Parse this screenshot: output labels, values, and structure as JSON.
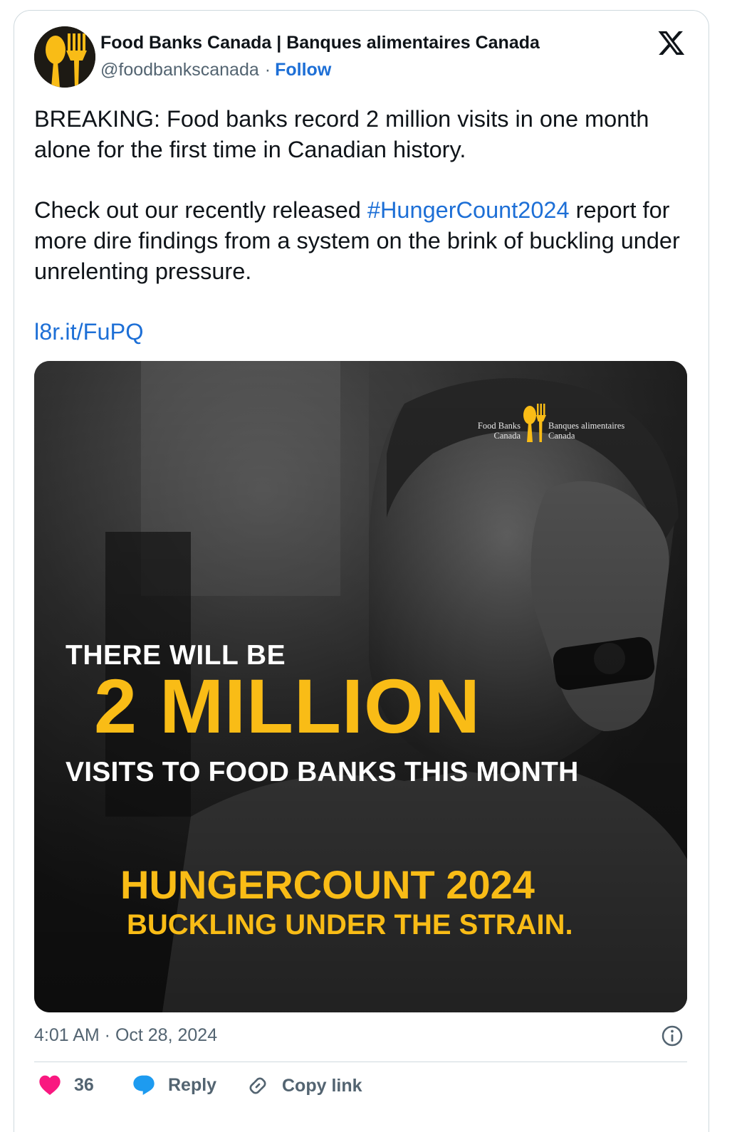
{
  "author": {
    "display_name": "Food Banks Canada | Banques alimentaires Canada",
    "handle": "@foodbankscanada",
    "separator": "·",
    "follow_label": "Follow"
  },
  "tweet": {
    "paragraph1": "BREAKING: Food banks record 2 million visits in one month alone for the first time in Canadian history.",
    "paragraph2_before": "Check out our recently released ",
    "hashtag": "#HungerCount2024",
    "paragraph2_after": " report for more dire findings from a system on the brink of buckling under unrelenting pressure.",
    "link": "l8r.it/FuPQ"
  },
  "media": {
    "brand_en_line1": "Food Banks",
    "brand_en_line2": "Canada",
    "brand_fr_line1": "Banques alimentaires",
    "brand_fr_line2": "Canada",
    "headline_top": "THERE WILL BE",
    "headline_big": "2 MILLION",
    "headline_bottom": "VISITS TO FOOD BANKS THIS MONTH",
    "campaign_title": "HUNGERCOUNT 2024",
    "campaign_subtitle": "BUCKLING UNDER THE STRAIN."
  },
  "footer": {
    "timestamp": "4:01 AM · Oct 28, 2024",
    "like_count": "36",
    "reply_label": "Reply",
    "copy_link_label": "Copy link"
  },
  "colors": {
    "link_blue": "#1d6fd6",
    "brand_yellow": "#f9bc16",
    "like_pink": "#f91880",
    "reply_blue": "#1d9bf0",
    "muted_gray": "#536471"
  },
  "icons": [
    "x-logo-icon",
    "fork-spoon-logo-icon",
    "info-icon",
    "heart-icon",
    "speech-bubble-icon",
    "link-icon"
  ]
}
